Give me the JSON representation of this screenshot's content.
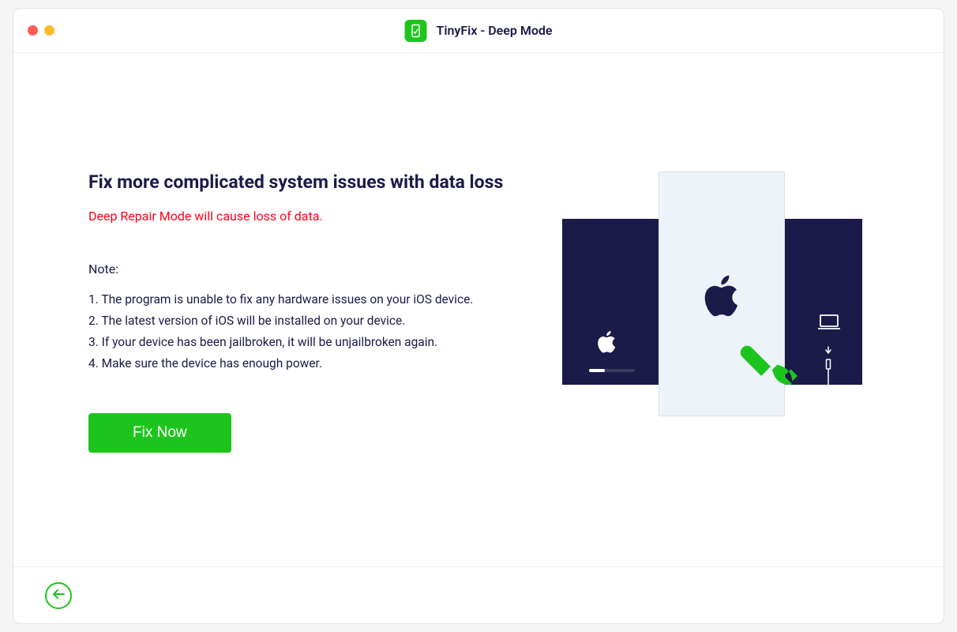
{
  "window": {
    "title": "TinyFix - Deep Mode"
  },
  "main": {
    "heading": "Fix more complicated system issues with data loss",
    "warning": "Deep Repair Mode will cause loss of data.",
    "note_label": "Note:",
    "notes": [
      "1. The program is unable to fix any hardware issues on your iOS device.",
      "2. The latest version of iOS will be installed on your device.",
      "3. If your device has been jailbroken, it will be unjailbroken again.",
      "4. Make sure the device has enough power."
    ],
    "fix_button_label": "Fix Now"
  },
  "colors": {
    "accent": "#1ec41e",
    "dark": "#1b1a49",
    "warning": "#ff0018"
  },
  "icons": {
    "app": "app-icon",
    "apple": "apple-icon",
    "wrench": "wrench-icon",
    "laptop": "laptop-icon",
    "back": "back-arrow-icon"
  }
}
